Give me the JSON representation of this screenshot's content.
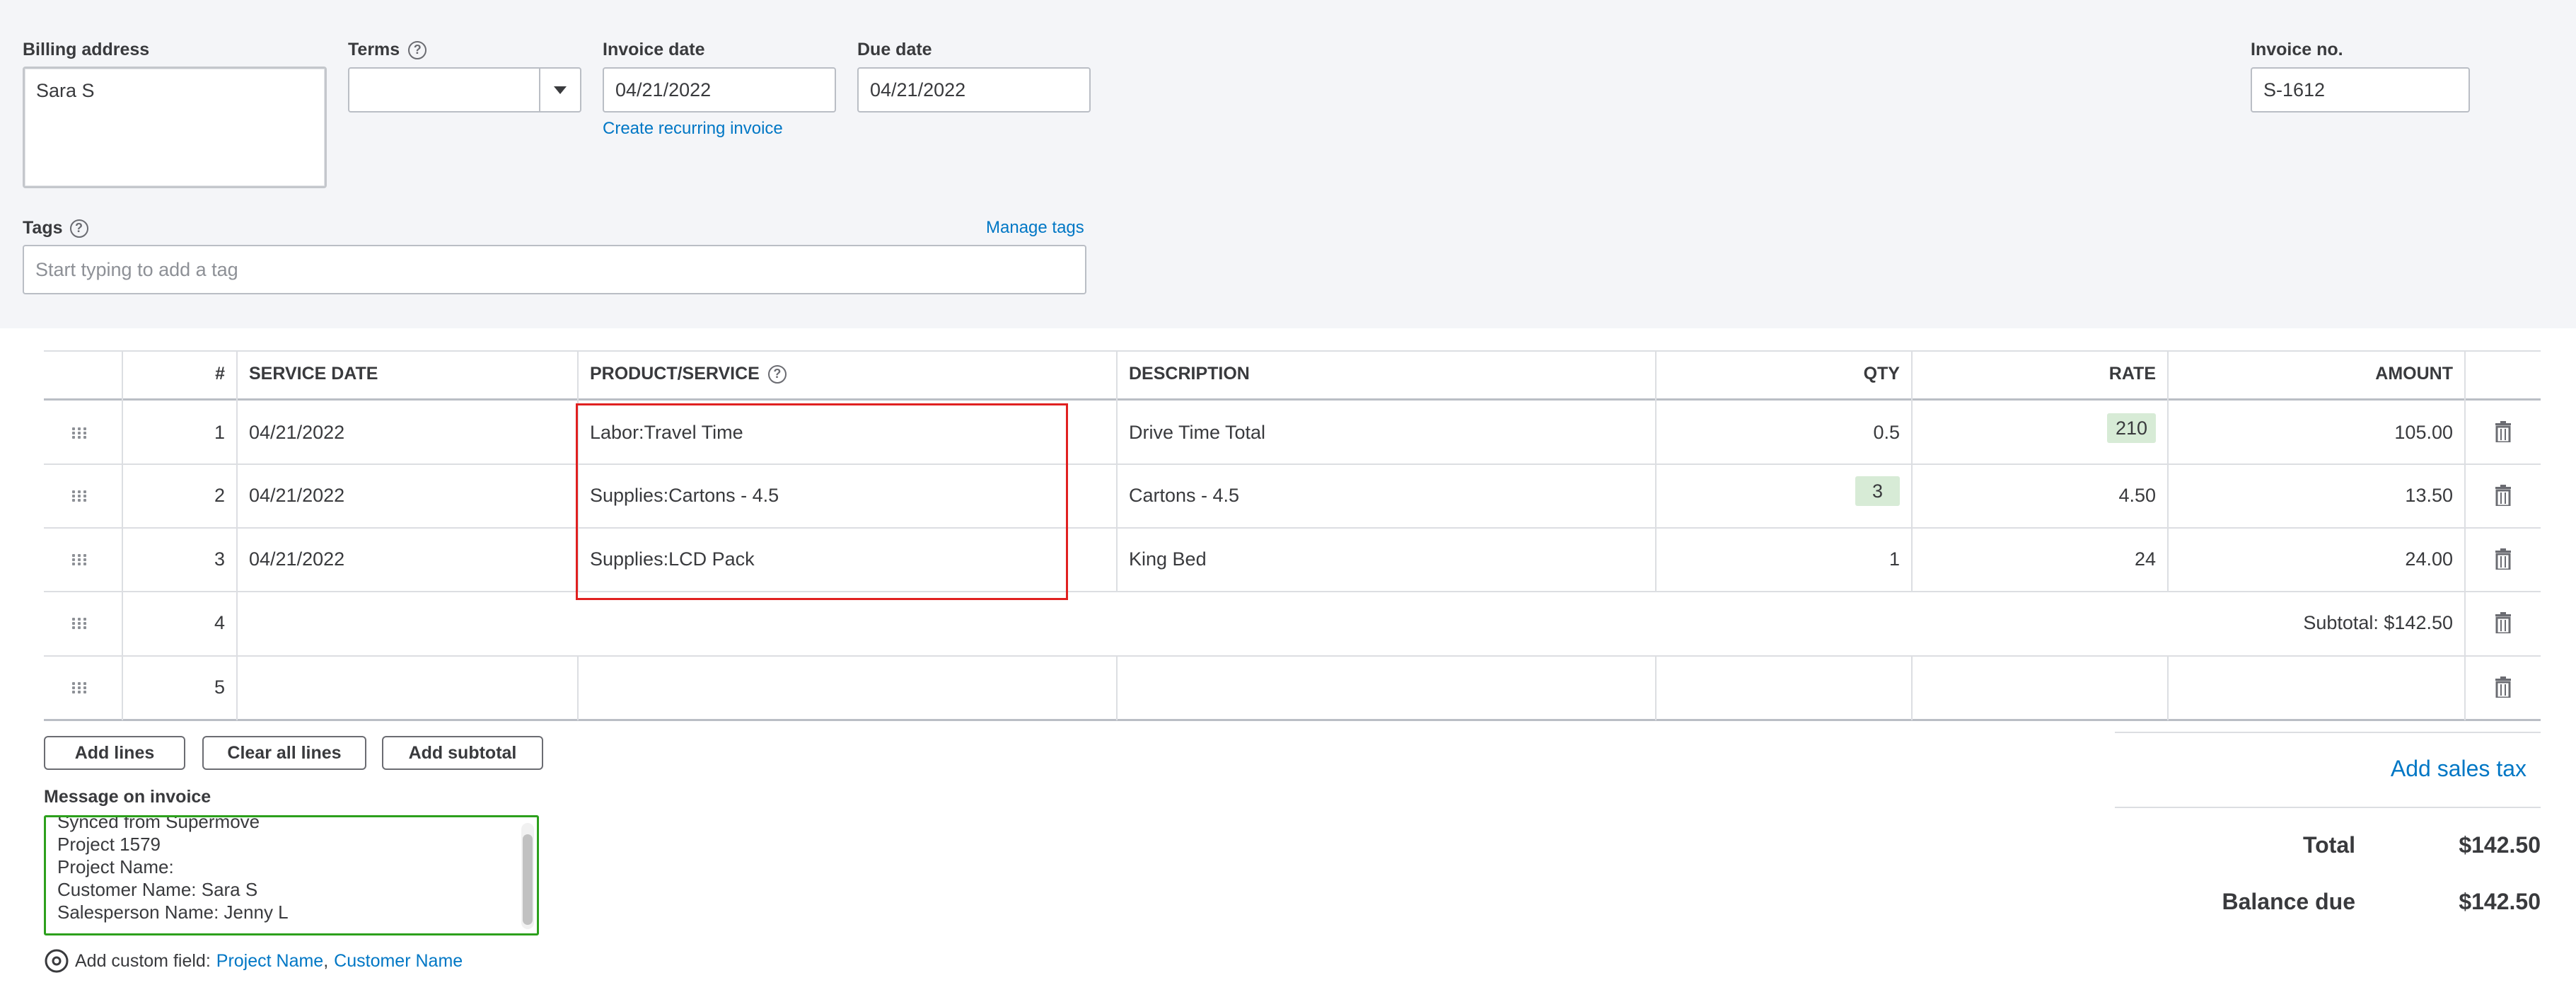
{
  "billing": {
    "label": "Billing address",
    "value": "Sara S"
  },
  "terms": {
    "label": "Terms",
    "value": ""
  },
  "invoice_date": {
    "label": "Invoice date",
    "value": "04/21/2022",
    "recurring_link": "Create recurring invoice"
  },
  "due_date": {
    "label": "Due date",
    "value": "04/21/2022"
  },
  "invoice_no": {
    "label": "Invoice no.",
    "value": "S-1612"
  },
  "tags": {
    "label": "Tags",
    "placeholder": "Start typing to add a tag",
    "manage_link": "Manage tags"
  },
  "help_glyph": "?",
  "table": {
    "headers": {
      "num": "#",
      "service_date": "SERVICE DATE",
      "product": "PRODUCT/SERVICE",
      "description": "DESCRIPTION",
      "qty": "QTY",
      "rate": "RATE",
      "amount": "AMOUNT"
    },
    "rows": [
      {
        "num": "1",
        "date": "04/21/2022",
        "product": "Labor:Travel Time",
        "description": "Drive Time Total",
        "qty": "0.5",
        "rate": "210",
        "amount": "105.00"
      },
      {
        "num": "2",
        "date": "04/21/2022",
        "product": "Supplies:Cartons - 4.5",
        "description": "Cartons - 4.5",
        "qty": "3",
        "rate": "4.50",
        "amount": "13.50"
      },
      {
        "num": "3",
        "date": "04/21/2022",
        "product": "Supplies:LCD Pack",
        "description": "King Bed",
        "qty": "1",
        "rate": "24",
        "amount": "24.00"
      },
      {
        "num": "4",
        "subtotal": "Subtotal: $142.50"
      },
      {
        "num": "5"
      }
    ]
  },
  "buttons": {
    "add_lines": "Add lines",
    "clear_all": "Clear all lines",
    "add_subtotal": "Add subtotal"
  },
  "message": {
    "label": "Message on invoice",
    "lines": [
      "Synced from Supermove",
      "Project 1579",
      "Project Name:",
      "Customer Name: Sara S",
      "Salesperson Name: Jenny L"
    ]
  },
  "custom_field": {
    "label": "Add custom field:",
    "link1": "Project Name",
    "separator": ",",
    "link2": "Customer Name"
  },
  "totals": {
    "add_sales_tax": "Add sales tax",
    "total_label": "Total",
    "total_value": "$142.50",
    "balance_label": "Balance due",
    "balance_value": "$142.50"
  },
  "colors": {
    "link": "#0077c5",
    "highlight_border": "#e02020",
    "focus_green": "#2ca01c",
    "auto_fill": "#d7ebd6"
  }
}
